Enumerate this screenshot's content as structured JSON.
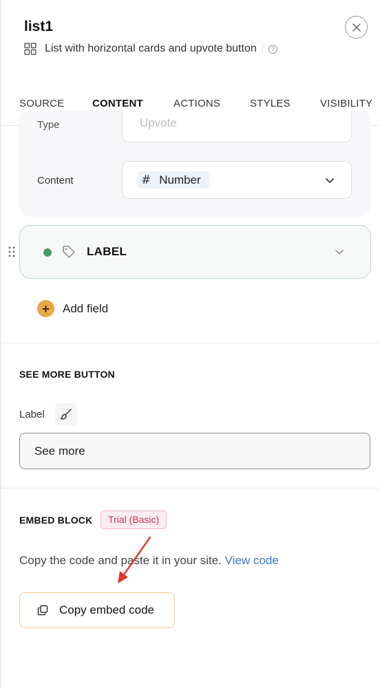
{
  "header": {
    "title": "list1",
    "subtitle": "List with horizontal cards and upvote button",
    "help_glyph": "?"
  },
  "tabs": [
    {
      "label": "SOURCE"
    },
    {
      "label": "CONTENT",
      "active": true
    },
    {
      "label": "ACTIONS"
    },
    {
      "label": "STYLES"
    },
    {
      "label": "VISIBILITY"
    }
  ],
  "field_card": {
    "type_label": "Type",
    "type_value": "Upvote",
    "content_label": "Content",
    "content_value": "Number"
  },
  "label_field": {
    "label": "LABEL",
    "status_color": "#4a9a6e"
  },
  "add_field": {
    "label": "Add field",
    "plus_glyph": "+"
  },
  "see_more": {
    "section_title": "SEE MORE BUTTON",
    "label_caption": "Label",
    "input_value": "See more"
  },
  "embed": {
    "section_title": "EMBED BLOCK",
    "badge": "Trial (Basic)",
    "description": "Copy the code and paste it in your site.",
    "link_text": "View code",
    "copy_button": "Copy embed code"
  },
  "colors": {
    "accent": "#e8a33d",
    "link": "#3a74c4",
    "badge_text": "#b83a55",
    "annotation_arrow": "#e0392b"
  }
}
